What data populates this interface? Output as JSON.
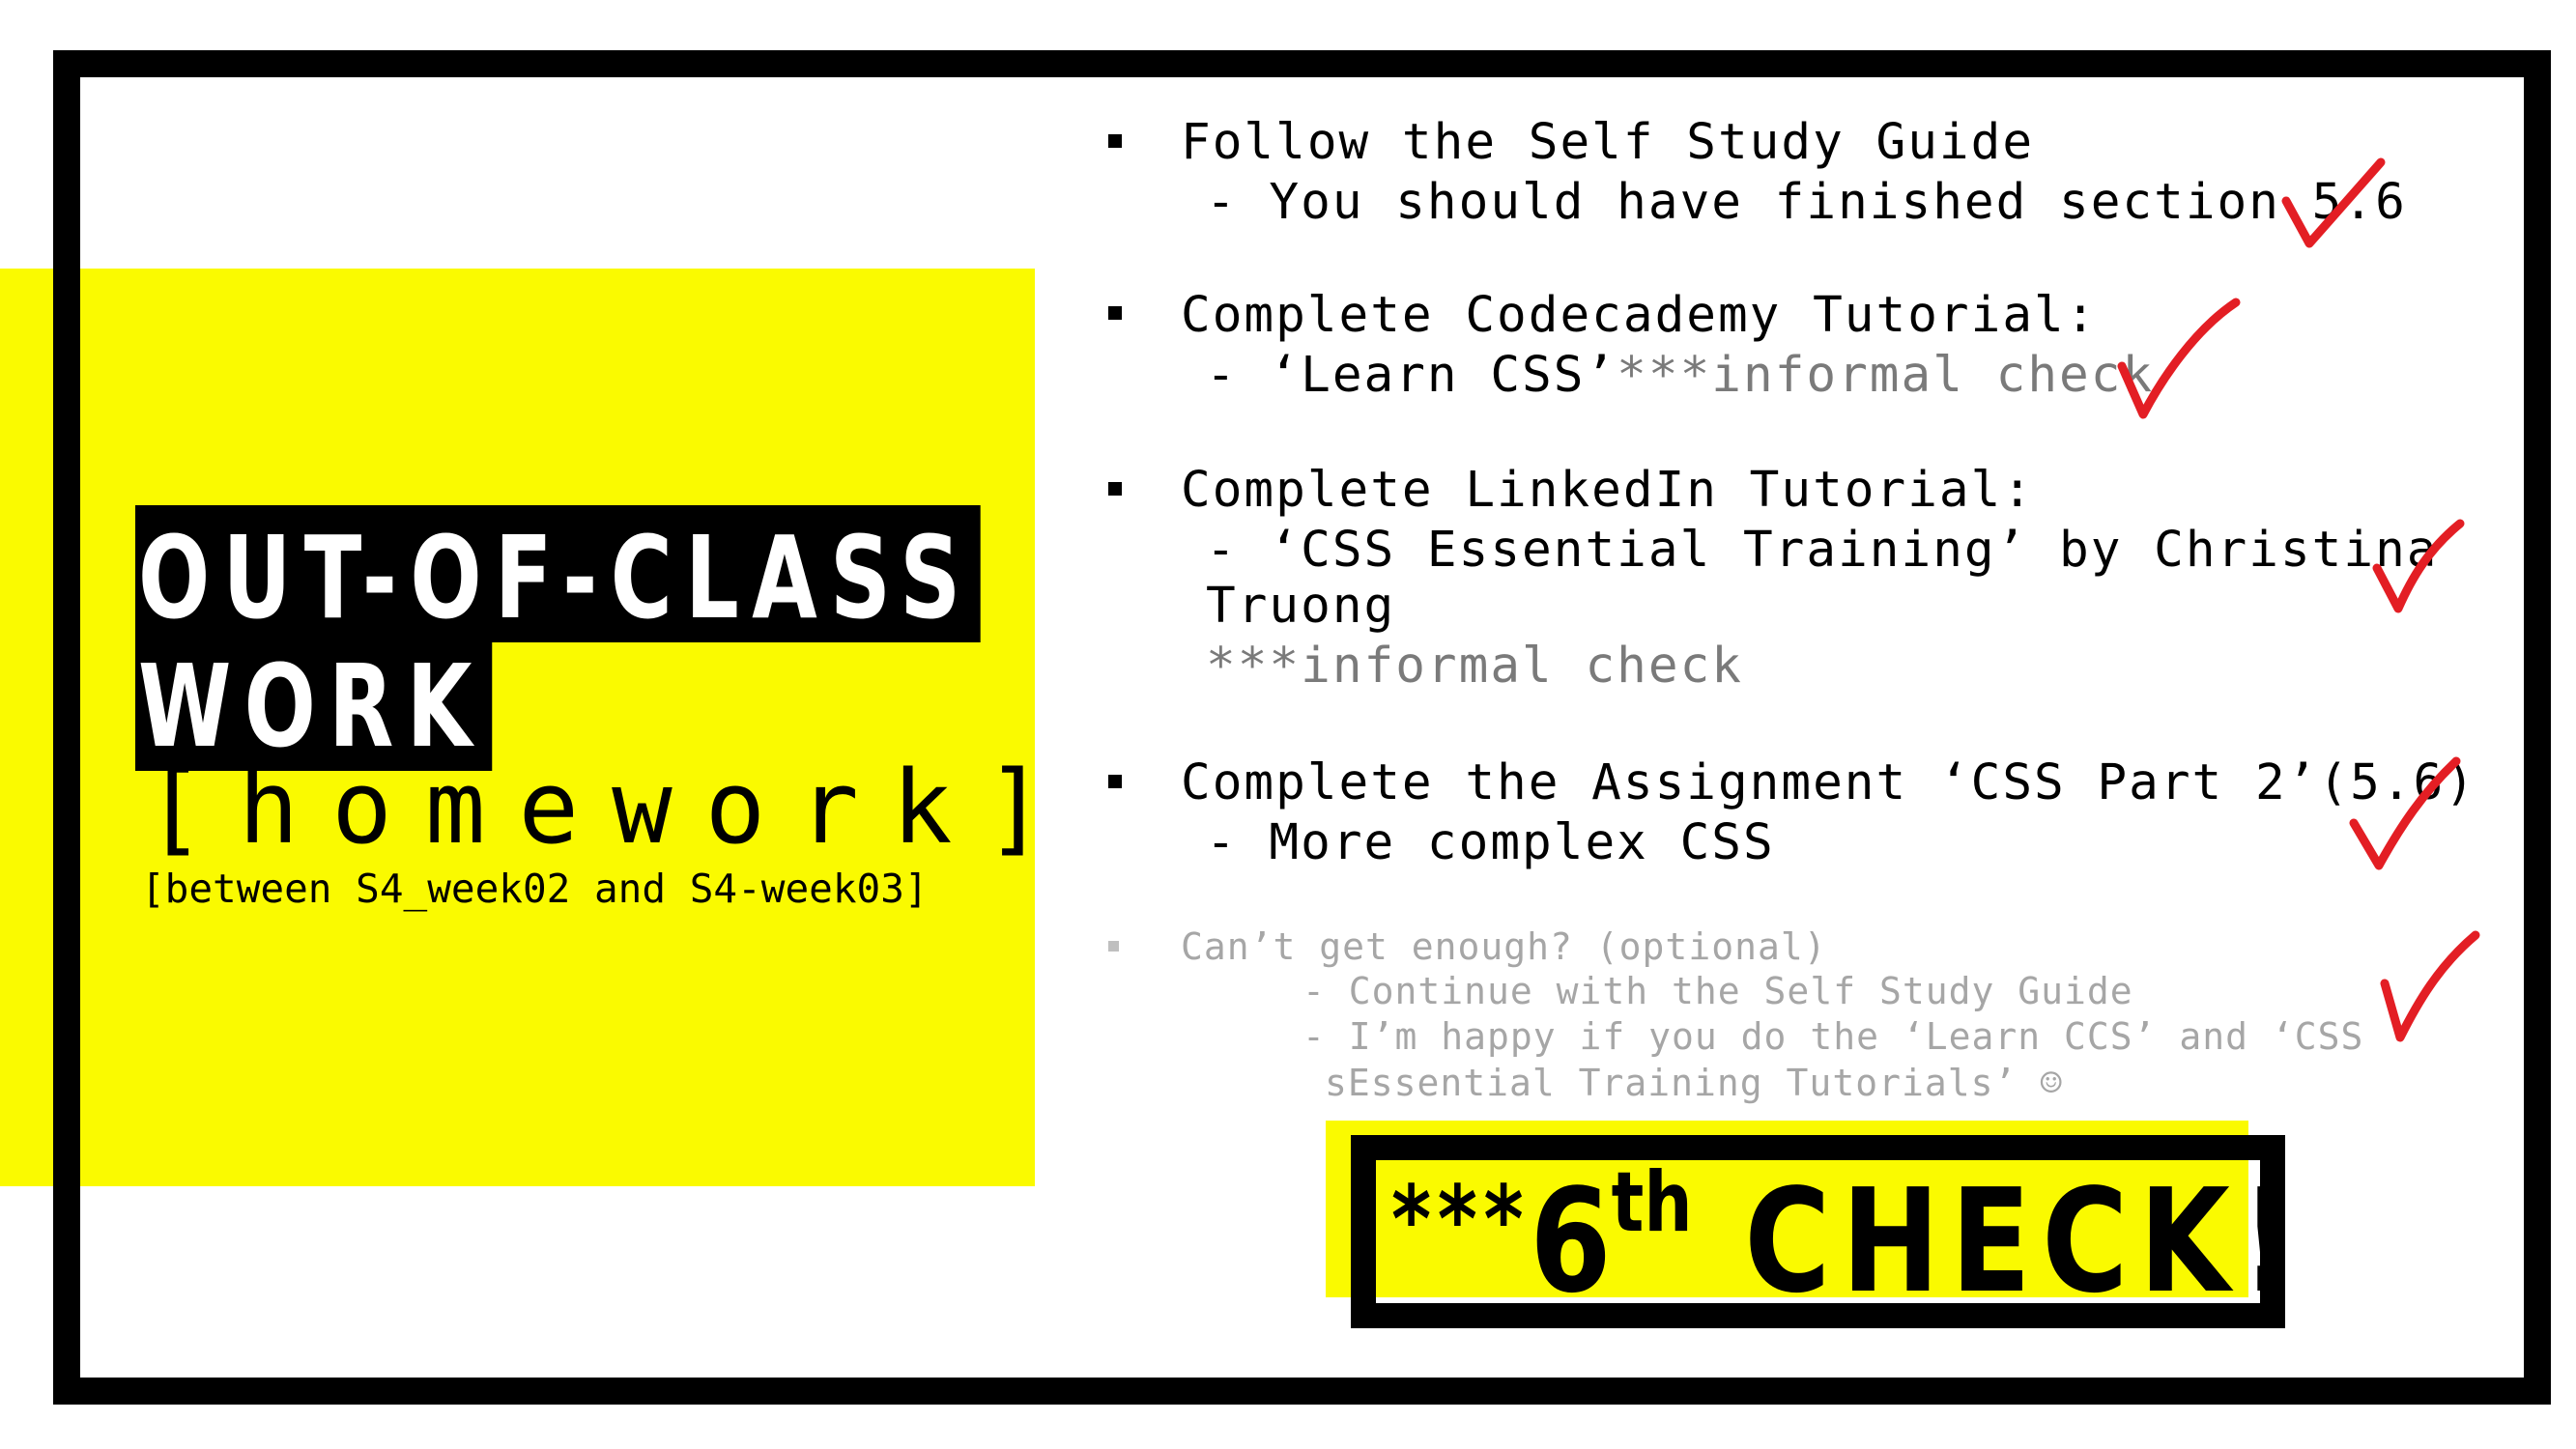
{
  "left_panel": {
    "title_line1": "OUT-OF-CLASS",
    "title_line2": "WORK",
    "homework": "[homework]",
    "subtitle": "[between S4_week02 and S4-week03]"
  },
  "tasks": [
    {
      "heading": "Follow the Self Study Guide",
      "detail": "-  You should have finished section 5.6"
    },
    {
      "heading": "Complete Codecademy Tutorial:",
      "detail": "- ‘Learn CSS’",
      "note": "***informal check"
    },
    {
      "heading": "Complete LinkedIn Tutorial:",
      "detail": "- ‘CSS Essential Training’ by Christina",
      "detail2": "Truong",
      "note": "***informal check"
    },
    {
      "heading": "Complete the Assignment ‘CSS Part 2’(5.6)",
      "detail": "- More complex CSS"
    }
  ],
  "optional": {
    "heading": "Can’t get enough? (optional)",
    "line1": "- Continue with the Self Study Guide",
    "line2": "- I’m happy if you do the ‘Learn CCS’ and ‘CSS",
    "line3": "sEssential Training Tutorials’ ☺"
  },
  "banner": {
    "stars": "***",
    "number": "6",
    "suffix": "th",
    "word": "CHECK!"
  },
  "colors": {
    "highlight": "#fafa00",
    "frame": "#000000",
    "checkmark": "#e31e24",
    "muted_text": "#7a7a7a",
    "optional_text": "#a6a6a6"
  },
  "icons": [
    "red-checkmark-icon",
    "square-bullet-icon"
  ]
}
